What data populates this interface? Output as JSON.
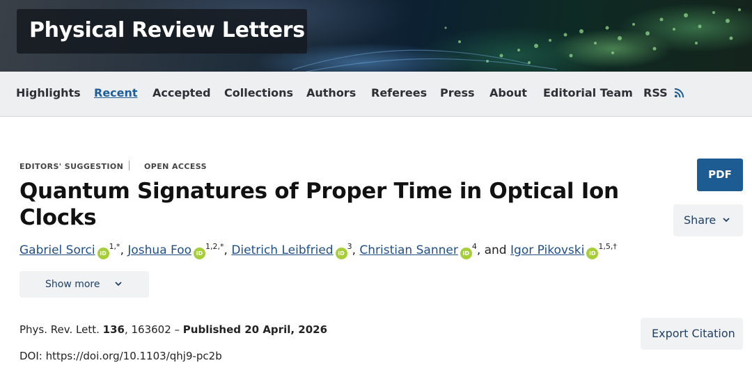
{
  "header": {
    "journal_title": "Physical Review Letters"
  },
  "nav": {
    "items": [
      {
        "label": "Highlights"
      },
      {
        "label": "Recent"
      },
      {
        "label": "Accepted"
      },
      {
        "label": "Collections"
      },
      {
        "label": "Authors"
      },
      {
        "label": "Referees"
      },
      {
        "label": "Press"
      },
      {
        "label": "About"
      },
      {
        "label": "Editorial Team"
      },
      {
        "label": "RSS"
      }
    ],
    "active": "Recent"
  },
  "article": {
    "tags": [
      "EDITORS' SUGGESTION",
      "OPEN ACCESS"
    ],
    "title": "Quantum Signatures of Proper Time in Optical Ion Clocks",
    "authors": [
      {
        "name": "Gabriel Sorci",
        "aff": "1,*"
      },
      {
        "name": "Joshua Foo",
        "aff": "1,2,*"
      },
      {
        "name": "Dietrich Leibfried",
        "aff": "3"
      },
      {
        "name": "Christian Sanner",
        "aff": "4"
      },
      {
        "name": "Igor Pikovski",
        "aff": "1,5,†"
      }
    ],
    "author_separator": ", ",
    "author_conjunction": ", and ",
    "orcid_label": "iD",
    "show_more_label": "Show more",
    "citation": {
      "journal": "Phys. Rev. Lett. ",
      "volume": "136",
      "article_number": ", 163602 – ",
      "published": "Published 20 April, 2026"
    },
    "doi": "DOI: https://doi.org/10.1103/qhj9-pc2b"
  },
  "actions": {
    "pdf_label": "PDF",
    "share_label": "Share",
    "export_label": "Export Citation"
  },
  "colors": {
    "accent": "#1d5c93",
    "link": "#1f4f86",
    "orcid": "#a6ce39",
    "nav_bg": "#eeeff0"
  },
  "icons": [
    "rss-icon",
    "orcid-icon",
    "chevron-down-icon"
  ]
}
